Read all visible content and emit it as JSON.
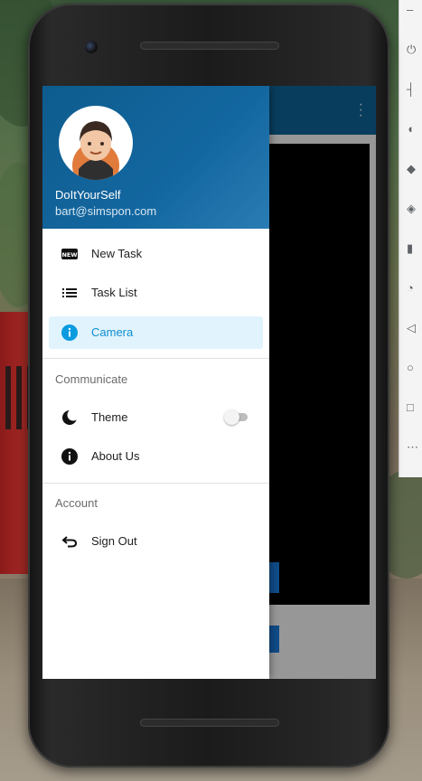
{
  "drawer": {
    "user": {
      "name": "DoItYourSelf",
      "email": "bart@simspon.com"
    },
    "items": [
      {
        "label": "New Task",
        "icon": "new-badge-icon",
        "active": false
      },
      {
        "label": "Task List",
        "icon": "list-icon",
        "active": false
      },
      {
        "label": "Camera",
        "icon": "info-icon",
        "active": true
      }
    ],
    "communicate": {
      "title": "Communicate",
      "theme_label": "Theme",
      "theme_toggle_on": false,
      "about_label": "About Us"
    },
    "account": {
      "title": "Account",
      "sign_out_label": "Sign Out"
    }
  },
  "icons": {
    "new_badge_text": "NEW"
  },
  "colors": {
    "header": "#0f5f8f",
    "active_bg": "#e1f3fd",
    "active_text": "#0d8fd1"
  }
}
